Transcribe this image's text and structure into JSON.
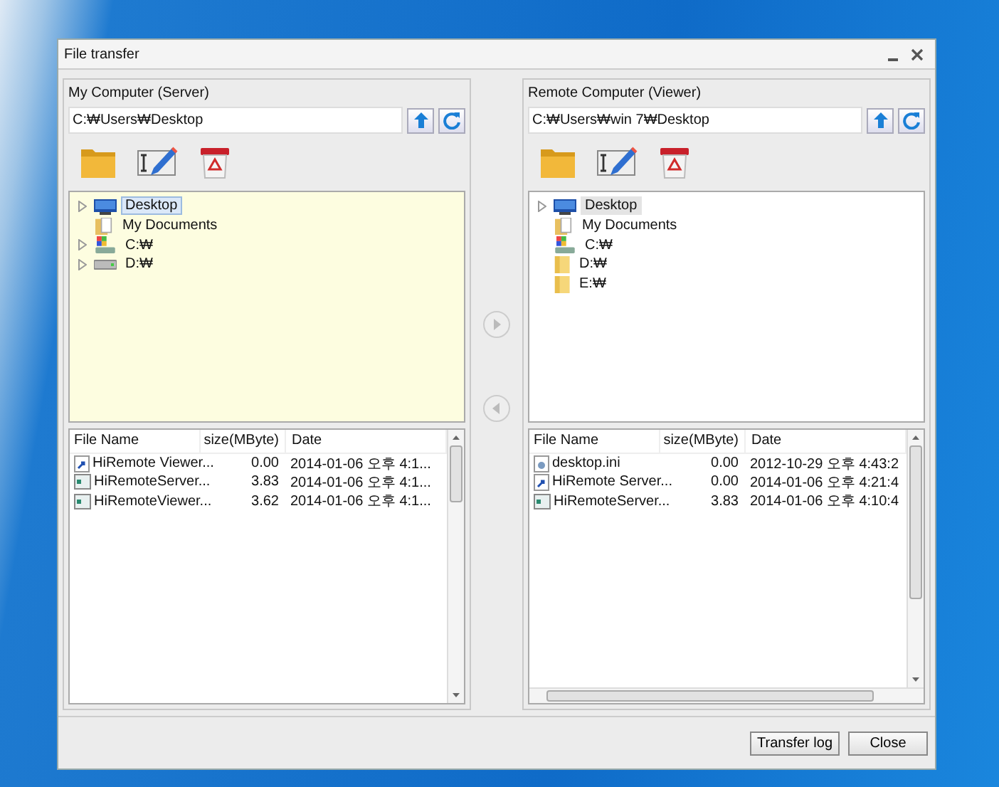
{
  "window": {
    "title": "File transfer"
  },
  "panels": [
    {
      "title": "My Computer (Server)",
      "path": "C:₩Users₩Desktop",
      "tree": {
        "focused": true,
        "items": [
          {
            "label": "Desktop",
            "kind": "desktop",
            "expandable": true,
            "selected": true
          },
          {
            "label": "My Documents",
            "kind": "documents",
            "expandable": false,
            "selected": false
          },
          {
            "label": "C:₩",
            "kind": "system-drive",
            "expandable": true,
            "selected": false
          },
          {
            "label": "D:₩",
            "kind": "drive",
            "expandable": true,
            "selected": false
          }
        ]
      },
      "list": {
        "columns": [
          "File Name",
          "size(MByte)",
          "Date"
        ],
        "horizontal_scrollbar": false,
        "rows": [
          {
            "name": "HiRemote Viewer...",
            "kind": "shortcut",
            "size": "0.00",
            "date": "2014-01-06 오후 4:1..."
          },
          {
            "name": "HiRemoteServer...",
            "kind": "program",
            "size": "3.83",
            "date": "2014-01-06 오후 4:1..."
          },
          {
            "name": "HiRemoteViewer...",
            "kind": "program",
            "size": "3.62",
            "date": "2014-01-06 오후 4:1..."
          }
        ]
      }
    },
    {
      "title": "Remote Computer (Viewer)",
      "path": "C:₩Users₩win 7₩Desktop",
      "tree": {
        "focused": false,
        "items": [
          {
            "label": "Desktop",
            "kind": "desktop",
            "expandable": true,
            "selected": true
          },
          {
            "label": "My Documents",
            "kind": "documents",
            "expandable": false,
            "selected": false
          },
          {
            "label": "C:₩",
            "kind": "system-drive",
            "expandable": false,
            "selected": false
          },
          {
            "label": "D:₩",
            "kind": "folder",
            "expandable": false,
            "selected": false
          },
          {
            "label": "E:₩",
            "kind": "folder",
            "expandable": false,
            "selected": false
          }
        ]
      },
      "list": {
        "columns": [
          "File Name",
          "size(MByte)",
          "Date"
        ],
        "horizontal_scrollbar": true,
        "rows": [
          {
            "name": "desktop.ini",
            "kind": "settings",
            "size": "0.00",
            "date": "2012-10-29 오후 4:43:2"
          },
          {
            "name": "HiRemote Server...",
            "kind": "shortcut",
            "size": "0.00",
            "date": "2014-01-06 오후 4:21:4"
          },
          {
            "name": "HiRemoteServer...",
            "kind": "program",
            "size": "3.83",
            "date": "2014-01-06 오후 4:10:4"
          }
        ]
      }
    }
  ],
  "buttons": [
    "Transfer log",
    "Close"
  ]
}
